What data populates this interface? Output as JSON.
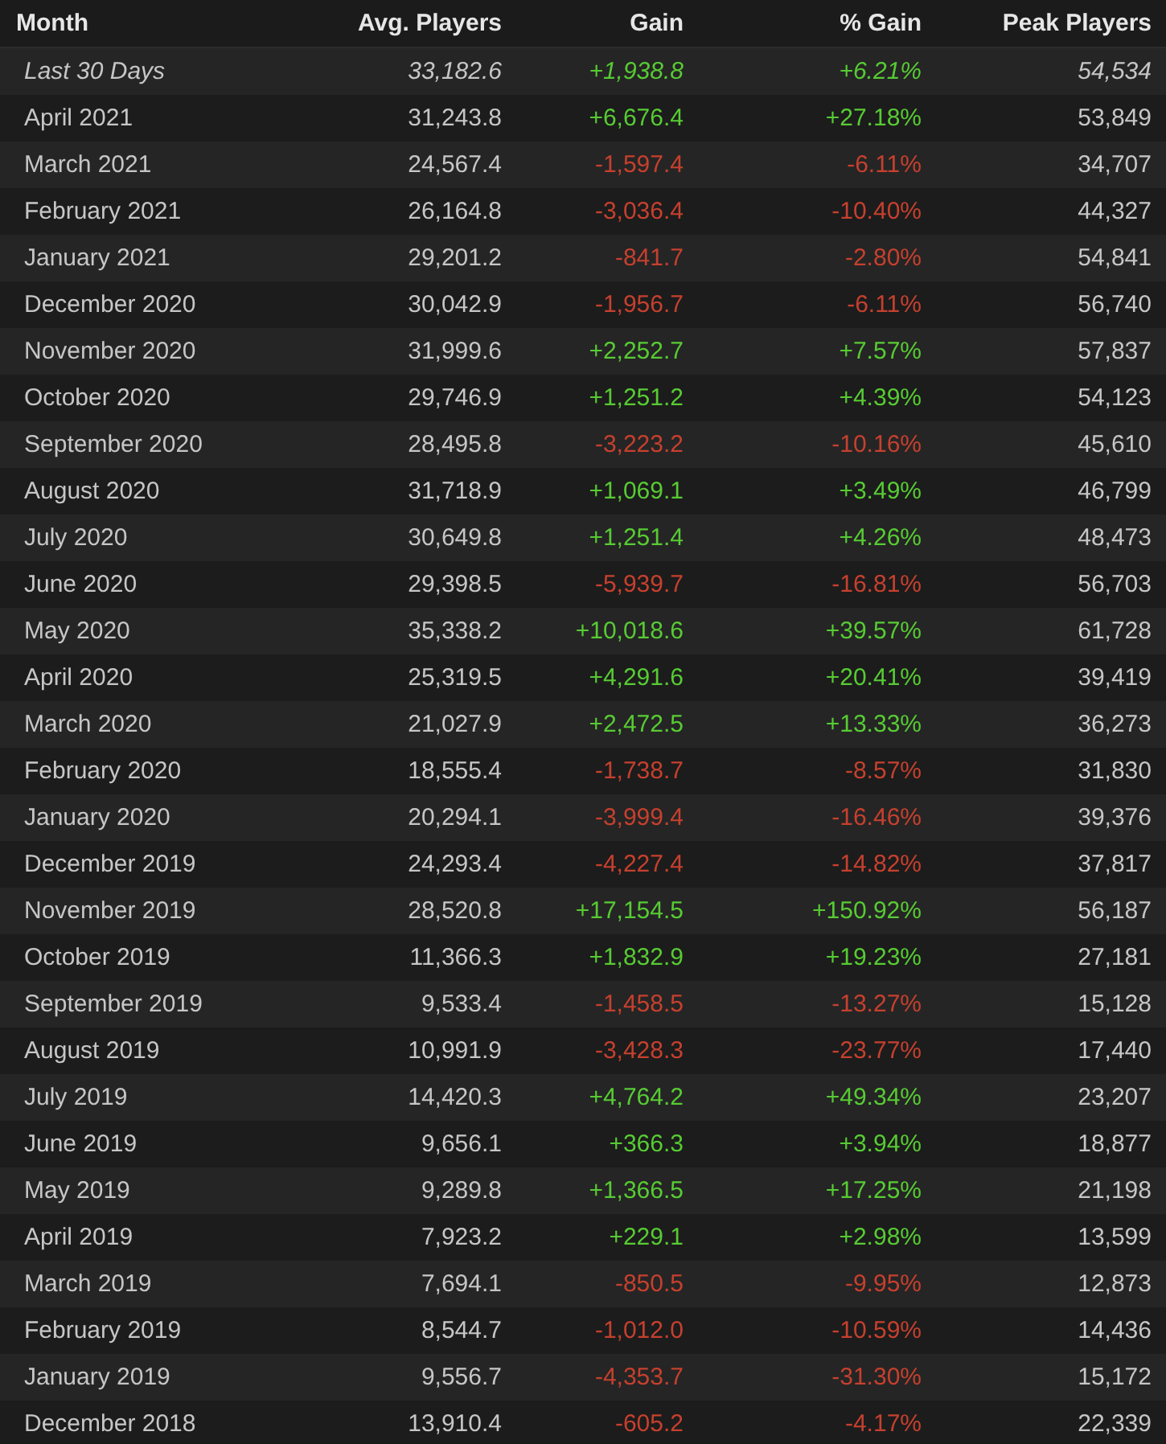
{
  "table": {
    "columns": [
      "Month",
      "Avg. Players",
      "Gain",
      "% Gain",
      "Peak Players"
    ],
    "rows": [
      {
        "italic": true,
        "kind": "gain",
        "cells": [
          "Last 30 Days",
          "33,182.6",
          "+1,938.8",
          "+6.21%",
          "54,534"
        ]
      },
      {
        "italic": false,
        "kind": "gain",
        "cells": [
          "April 2021",
          "31,243.8",
          "+6,676.4",
          "+27.18%",
          "53,849"
        ]
      },
      {
        "italic": false,
        "kind": "loss",
        "cells": [
          "March 2021",
          "24,567.4",
          "-1,597.4",
          "-6.11%",
          "34,707"
        ]
      },
      {
        "italic": false,
        "kind": "loss",
        "cells": [
          "February 2021",
          "26,164.8",
          "-3,036.4",
          "-10.40%",
          "44,327"
        ]
      },
      {
        "italic": false,
        "kind": "loss",
        "cells": [
          "January 2021",
          "29,201.2",
          "-841.7",
          "-2.80%",
          "54,841"
        ]
      },
      {
        "italic": false,
        "kind": "loss",
        "cells": [
          "December 2020",
          "30,042.9",
          "-1,956.7",
          "-6.11%",
          "56,740"
        ]
      },
      {
        "italic": false,
        "kind": "gain",
        "cells": [
          "November 2020",
          "31,999.6",
          "+2,252.7",
          "+7.57%",
          "57,837"
        ]
      },
      {
        "italic": false,
        "kind": "gain",
        "cells": [
          "October 2020",
          "29,746.9",
          "+1,251.2",
          "+4.39%",
          "54,123"
        ]
      },
      {
        "italic": false,
        "kind": "loss",
        "cells": [
          "September 2020",
          "28,495.8",
          "-3,223.2",
          "-10.16%",
          "45,610"
        ]
      },
      {
        "italic": false,
        "kind": "gain",
        "cells": [
          "August 2020",
          "31,718.9",
          "+1,069.1",
          "+3.49%",
          "46,799"
        ]
      },
      {
        "italic": false,
        "kind": "gain",
        "cells": [
          "July 2020",
          "30,649.8",
          "+1,251.4",
          "+4.26%",
          "48,473"
        ]
      },
      {
        "italic": false,
        "kind": "loss",
        "cells": [
          "June 2020",
          "29,398.5",
          "-5,939.7",
          "-16.81%",
          "56,703"
        ]
      },
      {
        "italic": false,
        "kind": "gain",
        "cells": [
          "May 2020",
          "35,338.2",
          "+10,018.6",
          "+39.57%",
          "61,728"
        ]
      },
      {
        "italic": false,
        "kind": "gain",
        "cells": [
          "April 2020",
          "25,319.5",
          "+4,291.6",
          "+20.41%",
          "39,419"
        ]
      },
      {
        "italic": false,
        "kind": "gain",
        "cells": [
          "March 2020",
          "21,027.9",
          "+2,472.5",
          "+13.33%",
          "36,273"
        ]
      },
      {
        "italic": false,
        "kind": "loss",
        "cells": [
          "February 2020",
          "18,555.4",
          "-1,738.7",
          "-8.57%",
          "31,830"
        ]
      },
      {
        "italic": false,
        "kind": "loss",
        "cells": [
          "January 2020",
          "20,294.1",
          "-3,999.4",
          "-16.46%",
          "39,376"
        ]
      },
      {
        "italic": false,
        "kind": "loss",
        "cells": [
          "December 2019",
          "24,293.4",
          "-4,227.4",
          "-14.82%",
          "37,817"
        ]
      },
      {
        "italic": false,
        "kind": "gain",
        "cells": [
          "November 2019",
          "28,520.8",
          "+17,154.5",
          "+150.92%",
          "56,187"
        ]
      },
      {
        "italic": false,
        "kind": "gain",
        "cells": [
          "October 2019",
          "11,366.3",
          "+1,832.9",
          "+19.23%",
          "27,181"
        ]
      },
      {
        "italic": false,
        "kind": "loss",
        "cells": [
          "September 2019",
          "9,533.4",
          "-1,458.5",
          "-13.27%",
          "15,128"
        ]
      },
      {
        "italic": false,
        "kind": "loss",
        "cells": [
          "August 2019",
          "10,991.9",
          "-3,428.3",
          "-23.77%",
          "17,440"
        ]
      },
      {
        "italic": false,
        "kind": "gain",
        "cells": [
          "July 2019",
          "14,420.3",
          "+4,764.2",
          "+49.34%",
          "23,207"
        ]
      },
      {
        "italic": false,
        "kind": "gain",
        "cells": [
          "June 2019",
          "9,656.1",
          "+366.3",
          "+3.94%",
          "18,877"
        ]
      },
      {
        "italic": false,
        "kind": "gain",
        "cells": [
          "May 2019",
          "9,289.8",
          "+1,366.5",
          "+17.25%",
          "21,198"
        ]
      },
      {
        "italic": false,
        "kind": "gain",
        "cells": [
          "April 2019",
          "7,923.2",
          "+229.1",
          "+2.98%",
          "13,599"
        ]
      },
      {
        "italic": false,
        "kind": "loss",
        "cells": [
          "March 2019",
          "7,694.1",
          "-850.5",
          "-9.95%",
          "12,873"
        ]
      },
      {
        "italic": false,
        "kind": "loss",
        "cells": [
          "February 2019",
          "8,544.7",
          "-1,012.0",
          "-10.59%",
          "14,436"
        ]
      },
      {
        "italic": false,
        "kind": "loss",
        "cells": [
          "January 2019",
          "9,556.7",
          "-4,353.7",
          "-31.30%",
          "15,172"
        ]
      },
      {
        "italic": false,
        "kind": "loss",
        "cells": [
          "December 2018",
          "13,910.4",
          "-605.2",
          "-4.17%",
          "22,339"
        ]
      }
    ]
  }
}
